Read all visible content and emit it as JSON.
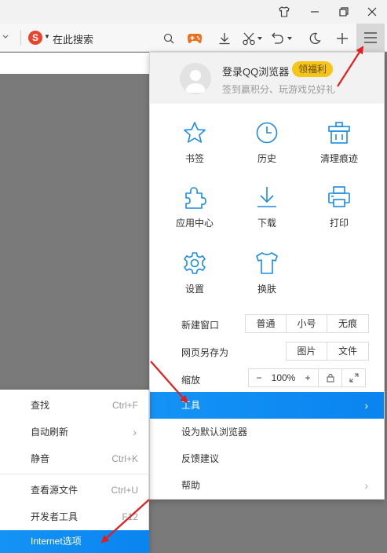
{
  "toolbar": {
    "search_placeholder": "在此搜索"
  },
  "login": {
    "title": "登录QQ浏览器",
    "badge": "领福利",
    "subtitle": "签到赢积分、玩游戏兑好礼"
  },
  "grid": [
    {
      "label": "书签",
      "icon": "star-icon"
    },
    {
      "label": "历史",
      "icon": "clock-icon"
    },
    {
      "label": "清理痕迹",
      "icon": "trash-icon"
    },
    {
      "label": "应用中心",
      "icon": "puzzle-icon"
    },
    {
      "label": "下载",
      "icon": "download-icon"
    },
    {
      "label": "打印",
      "icon": "printer-icon"
    },
    {
      "label": "设置",
      "icon": "gear-icon"
    },
    {
      "label": "换肤",
      "icon": "tshirt-icon"
    }
  ],
  "new_window": {
    "label": "新建窗口",
    "options": [
      "普通",
      "小号",
      "无痕"
    ]
  },
  "save_as": {
    "label": "网页另存为",
    "options": [
      "图片",
      "文件"
    ]
  },
  "zoom": {
    "label": "缩放",
    "minus": "−",
    "value": "100%",
    "plus": "+"
  },
  "menu_items": [
    {
      "label": "工具",
      "has_submenu": true
    },
    {
      "label": "设为默认浏览器"
    },
    {
      "label": "反馈建议"
    },
    {
      "label": "帮助",
      "has_submenu": true
    }
  ],
  "submenu": [
    {
      "label": "查找",
      "shortcut": "Ctrl+F"
    },
    {
      "label": "自动刷新",
      "shortcut": "›"
    },
    {
      "label": "静音",
      "shortcut": "Ctrl+K"
    },
    {
      "label": "查看源文件",
      "shortcut": "Ctrl+U"
    },
    {
      "label": "开发者工具",
      "shortcut": "F12"
    },
    {
      "label": "Internet选项",
      "shortcut": ""
    }
  ],
  "colors": {
    "accent": "#1493f5",
    "icon_blue": "#1d8ce0",
    "badge": "#f5c518",
    "arrow_red": "#e02020",
    "game_orange": "#f07020"
  }
}
